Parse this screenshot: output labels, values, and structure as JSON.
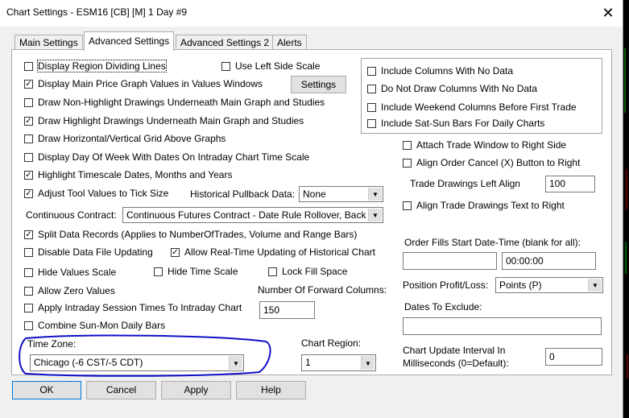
{
  "window": {
    "title": "Chart Settings - ESM16 [CB] [M]  1 Day  #9"
  },
  "tabs": [
    {
      "label": "Main Settings"
    },
    {
      "label": "Advanced Settings"
    },
    {
      "label": "Advanced Settings 2"
    },
    {
      "label": "Alerts"
    }
  ],
  "left_checks": [
    {
      "label": "Display Region Dividing Lines",
      "checked": false
    },
    {
      "label": "Display Main Price Graph Values in Values Windows",
      "checked": true
    },
    {
      "label": "Draw Non-Highlight Drawings Underneath Main Graph and Studies",
      "checked": false
    },
    {
      "label": "Draw Highlight Drawings Underneath Main Graph and Studies",
      "checked": true
    },
    {
      "label": "Draw Horizontal/Vertical Grid Above Graphs",
      "checked": false
    },
    {
      "label": "Display Day Of Week With Dates On Intraday Chart Time Scale",
      "checked": false
    },
    {
      "label": "Highlight Timescale Dates, Months and Years",
      "checked": true
    },
    {
      "label": "Adjust Tool Values to Tick Size",
      "checked": true
    },
    {
      "label": "Split Data Records (Applies to NumberOfTrades, Volume and Range Bars)",
      "checked": true
    },
    {
      "label": "Disable Data File Updating",
      "checked": false
    },
    {
      "label": "Hide Values Scale",
      "checked": false
    },
    {
      "label": "Allow Zero Values",
      "checked": false
    },
    {
      "label": "Apply Intraday Session Times To Intraday Chart",
      "checked": false
    },
    {
      "label": "Combine Sun-Mon Daily Bars",
      "checked": false
    }
  ],
  "use_left_side_scale": {
    "label": "Use Left Side Scale",
    "checked": false
  },
  "settings_button": "Settings",
  "historical_pullback": {
    "label": "Historical Pullback Data:",
    "value": "None"
  },
  "continuous_contract": {
    "label": "Continuous Contract:",
    "value": "Continuous Futures Contract - Date Rule Rollover, Back"
  },
  "allow_realtime": {
    "label": "Allow Real-Time Updating of Historical Chart",
    "checked": true
  },
  "hide_time_scale": {
    "label": "Hide Time Scale",
    "checked": false
  },
  "lock_fill_space": {
    "label": "Lock Fill Space",
    "checked": false
  },
  "forward_columns": {
    "label": "Number Of Forward Columns:",
    "value": "150"
  },
  "time_zone": {
    "label": "Time Zone:",
    "value": "Chicago (-6 CST/-5 CDT)"
  },
  "chart_region": {
    "label": "Chart Region:",
    "value": "1"
  },
  "group_checks": [
    {
      "label": "Include Columns With No Data",
      "checked": false
    },
    {
      "label": "Do Not Draw Columns With No Data",
      "checked": false
    },
    {
      "label": "Include Weekend Columns Before First Trade",
      "checked": false
    },
    {
      "label": "Include Sat-Sun Bars For Daily Charts",
      "checked": false
    }
  ],
  "trade_checks": [
    {
      "label": "Attach Trade Window to Right Side",
      "checked": false
    },
    {
      "label": "Align Order Cancel (X) Button to Right",
      "checked": false
    }
  ],
  "trade_drawings_left_align": {
    "label": "Trade Drawings Left Align",
    "value": "100"
  },
  "align_trade_text": {
    "label": "Align Trade Drawings Text to Right",
    "checked": false
  },
  "order_fills": {
    "label": "Order Fills Start Date-Time (blank for all):",
    "date": "",
    "time": "00:00:00"
  },
  "position_pl": {
    "label": "Position Profit/Loss:",
    "value": "Points (P)"
  },
  "dates_to_exclude": {
    "label": "Dates To Exclude:",
    "value": ""
  },
  "update_interval": {
    "label_line1": "Chart Update Interval In",
    "label_line2": "Milliseconds (0=Default):",
    "value": "0"
  },
  "buttons": {
    "ok": "OK",
    "cancel": "Cancel",
    "apply": "Apply",
    "help": "Help"
  },
  "colors": {
    "annotation_ring": "#1010c8",
    "side_line_green": "#00c000",
    "side_line_red": "#c00000"
  }
}
